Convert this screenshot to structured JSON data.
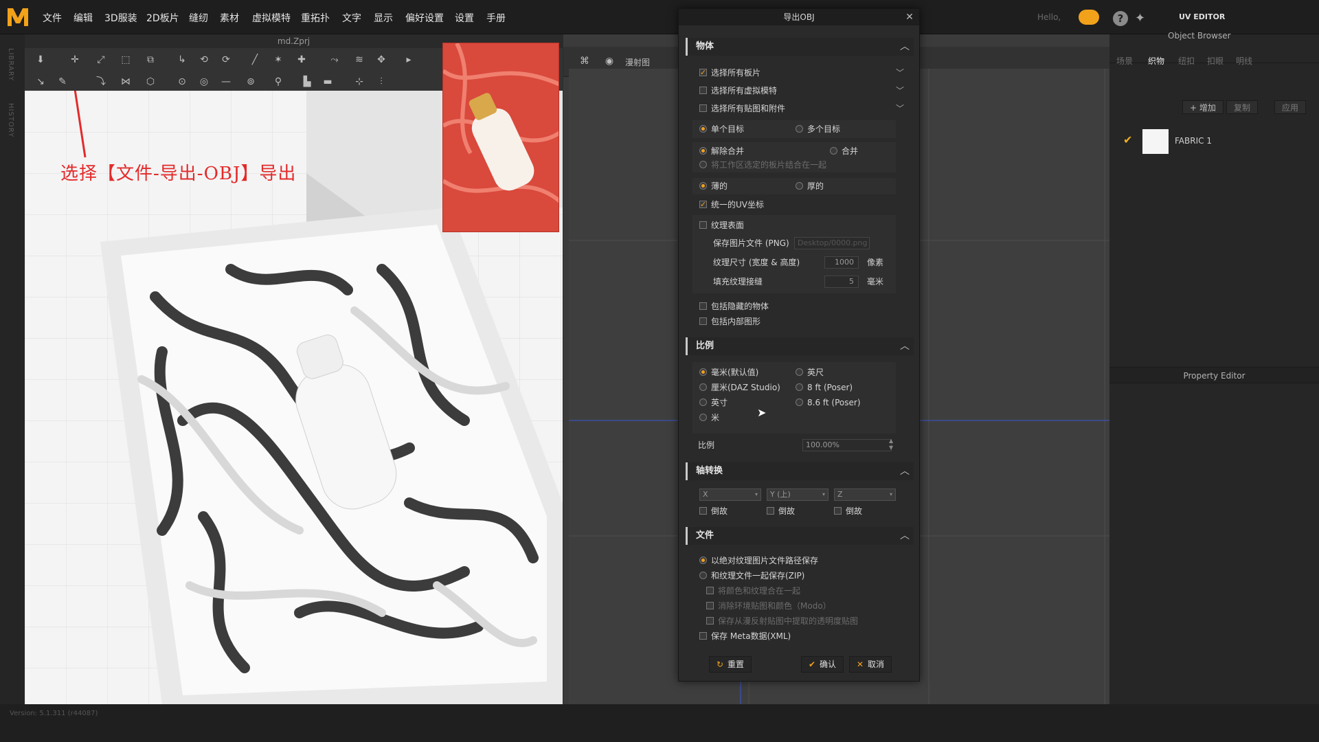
{
  "menu": [
    "文件",
    "编辑",
    "3D服装",
    "2D板片",
    "缝纫",
    "素材",
    "虚拟模特",
    "重拓扑",
    "文字",
    "显示",
    "偏好设置",
    "设置",
    "手册"
  ],
  "header": {
    "hello": "Hello,",
    "uv_editor": "UV EDITOR"
  },
  "left_strip": {
    "library": "LIBRARY",
    "history": "HISTORY"
  },
  "viewport3d": {
    "title": "md.Zprj",
    "annotation": "选择【文件-导出-OBJ】导出"
  },
  "viewport2d": {
    "tab": "漫射图"
  },
  "right_panel": {
    "tabs": [
      "场景",
      "织物",
      "纽扣",
      "扣眼",
      "明线"
    ],
    "active_tab": "织物",
    "browser_title": "Object Browser",
    "add_button": "+ 增加",
    "copy_button": "复制",
    "apply_button": "应用",
    "fabric_name": "FABRIC 1",
    "property_editor": "Property Editor"
  },
  "status": {
    "version": "Version: 5.1.311 (r44087)"
  },
  "dialog": {
    "title": "导出OBJ",
    "sections": {
      "object": "物体",
      "scale": "比例",
      "axis": "轴转换",
      "file": "文件"
    },
    "object": {
      "select_all_patterns": "选择所有板片",
      "select_all_avatars": "选择所有虚拟模特",
      "select_all_maps": "选择所有贴图和附件",
      "single_object": "单个目标",
      "multiple_object": "多个目标",
      "unmerge": "解除合并",
      "merge": "合并",
      "merge_selected": "将工作区选定的板片结合在一起",
      "thin": "薄的",
      "thick": "厚的",
      "unified_uv": "统一的UV坐标",
      "texture_surface": "纹理表面",
      "save_image_label": "保存图片文件 (PNG)",
      "save_image_path": "Desktop/0000.png",
      "texture_size_label": "纹理尺寸 (宽度 & 高度)",
      "texture_size_value": "1000",
      "texture_size_unit": "像素",
      "fill_seam_label": "填充纹理接缝",
      "fill_seam_value": "5",
      "fill_seam_unit": "毫米",
      "include_hidden": "包括隐藏的物体",
      "include_inner": "包括内部图形"
    },
    "scale": {
      "mm": "毫米(默认值)",
      "cm": "厘米(DAZ Studio)",
      "inch": "英寸",
      "m": "米",
      "ft": "英尺",
      "ft8": "8 ft (Poser)",
      "ft86": "8.6 ft (Poser)",
      "ratio_label": "比例",
      "ratio_value": "100.00%"
    },
    "axis": {
      "x": "X",
      "y": "Y (上)",
      "z": "Z",
      "flip": "倒故"
    },
    "file": {
      "abs_path": "以绝对纹理图片文件路径保存",
      "zip": "和纹理文件一起保存(ZIP)",
      "combine_color": "将颜色和纹理合在一起",
      "remove_env": "消除环境贴图和颜色（Modo）",
      "extract_alpha": "保存从漫反射贴图中提取的透明度贴图",
      "meta": "保存 Meta数据(XML)"
    },
    "buttons": {
      "reset": "重置",
      "ok": "确认",
      "cancel": "取消"
    }
  }
}
